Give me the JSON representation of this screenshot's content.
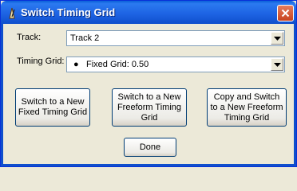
{
  "window": {
    "title": "Switch Timing Grid",
    "title_icon": "metronome-icon",
    "close_icon": "close-icon"
  },
  "track": {
    "label": "Track:",
    "value": "Track 2"
  },
  "timing_grid": {
    "label": "Timing Grid:",
    "value": "Fixed Grid: 0.50",
    "bullet_icon": "bullet-icon"
  },
  "buttons": {
    "switch_fixed": "Switch to a New\nFixed Timing Grid",
    "switch_freeform": "Switch to a New\nFreeform Timing\nGrid",
    "copy_switch": "Copy and Switch\nto a New Freeform\nTiming Grid",
    "done": "Done"
  },
  "colors": {
    "titlebar": "#1E64E4",
    "dialog_bg": "#ECE9D8",
    "close_button": "#C8431F"
  }
}
